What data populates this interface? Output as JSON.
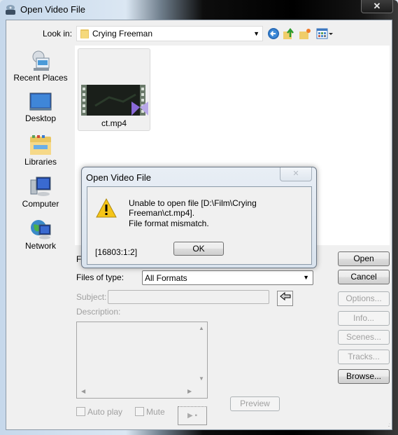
{
  "window": {
    "title": "Open Video File",
    "close_glyph": "✕"
  },
  "toolbar": {
    "look_in_label": "Look in:",
    "look_in_value": "Crying Freeman",
    "icons": [
      "back-icon",
      "up-folder-icon",
      "new-folder-icon",
      "view-menu-icon"
    ]
  },
  "places": [
    {
      "label": "Recent Places",
      "icon": "recent-places-icon"
    },
    {
      "label": "Desktop",
      "icon": "desktop-icon"
    },
    {
      "label": "Libraries",
      "icon": "libraries-icon"
    },
    {
      "label": "Computer",
      "icon": "computer-icon"
    },
    {
      "label": "Network",
      "icon": "network-icon"
    }
  ],
  "files": [
    {
      "name": "ct.mp4",
      "icon": "video-file-icon"
    }
  ],
  "form": {
    "file_name_label": "File name:",
    "file_name_label_visible": "Fi",
    "files_of_type_label": "Files of type:",
    "files_of_type_value": "All Formats",
    "subject_label": "Subject:",
    "subject_value": "",
    "description_label": "Description:",
    "auto_play_label": "Auto play",
    "auto_play_checked": false,
    "mute_label": "Mute",
    "mute_checked": false,
    "preview_label": "Preview",
    "play_glyph": "▶ ▪"
  },
  "buttons": {
    "open": "Open",
    "cancel": "Cancel",
    "options": "Options...",
    "info": "Info...",
    "scenes": "Scenes...",
    "tracks": "Tracks...",
    "browse": "Browse..."
  },
  "modal": {
    "title": "Open Video File",
    "close_glyph": "✕",
    "message": "Unable to open file [D:\\Film\\Crying Freeman\\ct.mp4].",
    "detail": "File format mismatch.",
    "code": "[16803:1:2]",
    "ok_label": "OK"
  }
}
